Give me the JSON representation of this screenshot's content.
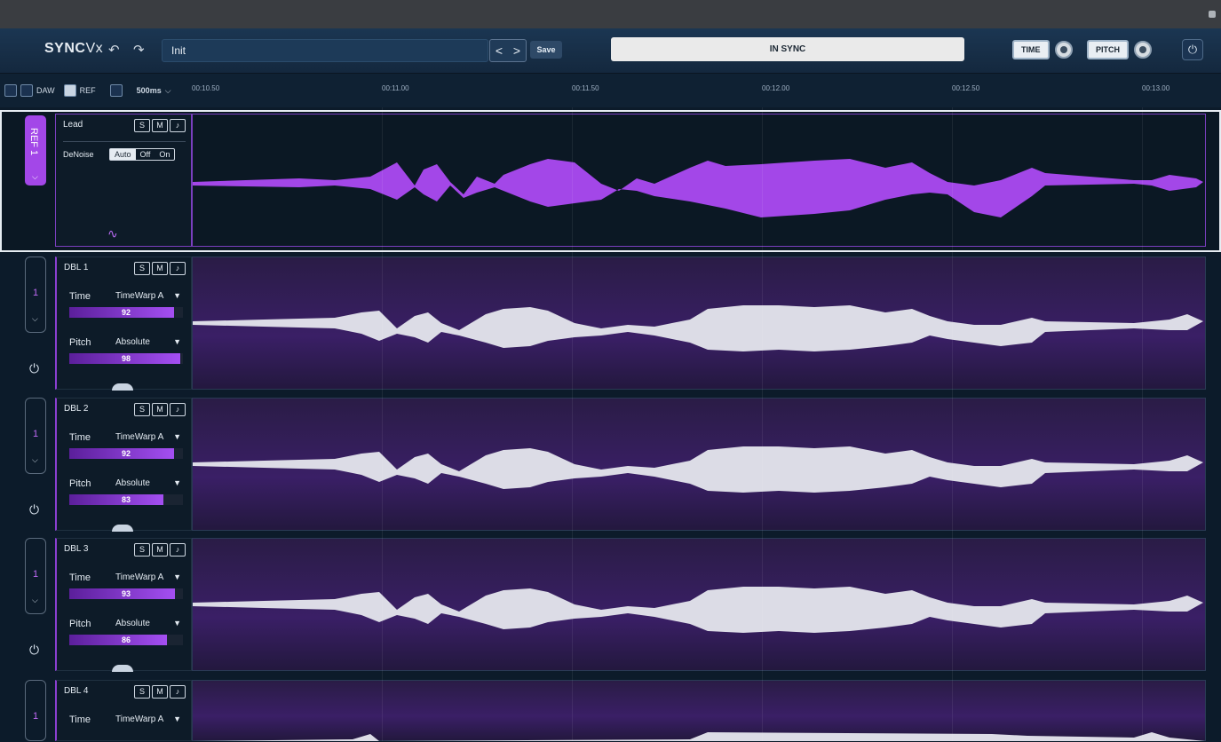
{
  "app": {
    "brand_bold": "SYNC",
    "brand_light": "Vx"
  },
  "header": {
    "undo_icon": "undo-icon",
    "redo_icon": "redo-icon",
    "preset_name": "Init",
    "prev_label": "<",
    "next_label": ">",
    "save_label": "Save",
    "sync_status": "IN SYNC",
    "time_label": "TIME",
    "pitch_label": "PITCH",
    "power_icon": "power-icon"
  },
  "ruler": {
    "daw_label": "DAW",
    "ref_label": "REF",
    "zoom_label": "500ms",
    "ticks": [
      "00:10.50",
      "00:11.00",
      "00:11.50",
      "00:12.00",
      "00:12.50",
      "00:13.00"
    ]
  },
  "ref_track": {
    "badge": "REF 1",
    "name": "Lead",
    "s_label": "S",
    "m_label": "M",
    "denoise_label": "DeNoise",
    "denoise_options": [
      "Auto",
      "Off",
      "On"
    ],
    "denoise_selected": "Auto"
  },
  "dbl_tracks": [
    {
      "name": "DBL 1",
      "ref_number": "1",
      "time_label": "Time",
      "time_mode": "TimeWarp A",
      "time_value": "92",
      "pitch_label": "Pitch",
      "pitch_mode": "Absolute",
      "pitch_value": "98"
    },
    {
      "name": "DBL 2",
      "ref_number": "1",
      "time_label": "Time",
      "time_mode": "TimeWarp A",
      "time_value": "92",
      "pitch_label": "Pitch",
      "pitch_mode": "Absolute",
      "pitch_value": "83"
    },
    {
      "name": "DBL 3",
      "ref_number": "1",
      "time_label": "Time",
      "time_mode": "TimeWarp A",
      "time_value": "93",
      "pitch_label": "Pitch",
      "pitch_mode": "Absolute",
      "pitch_value": "86"
    },
    {
      "name": "DBL 4",
      "ref_number": "1",
      "time_label": "Time",
      "time_mode": "TimeWarp A"
    }
  ],
  "colors": {
    "accent": "#a347e8",
    "ref_wave": "#a347e8",
    "dbl_wave": "#dcdce6",
    "background": "#0c1b2a"
  }
}
